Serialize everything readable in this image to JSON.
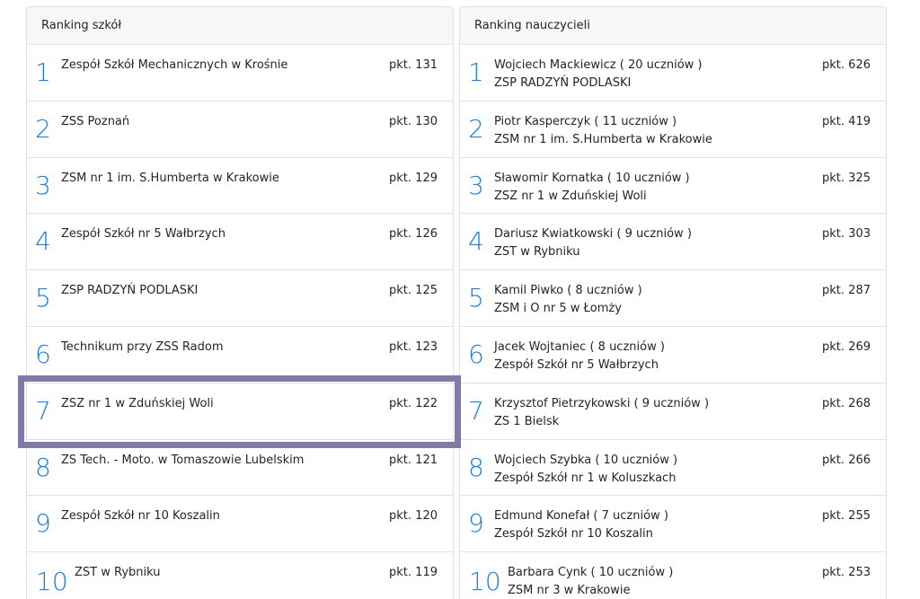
{
  "schools": {
    "title": "Ranking szkół",
    "rows": [
      {
        "rank": "1",
        "name": "Zespół Szkół Mechanicznych w Krośnie",
        "points": "pkt. 131"
      },
      {
        "rank": "2",
        "name": "ZSS Poznań",
        "points": "pkt. 130"
      },
      {
        "rank": "3",
        "name": "ZSM nr 1 im. S.Humberta w Krakowie",
        "points": "pkt. 129"
      },
      {
        "rank": "4",
        "name": "Zespół Szkół nr 5 Wałbrzych",
        "points": "pkt. 126"
      },
      {
        "rank": "5",
        "name": "ZSP RADZYŃ PODLASKI",
        "points": "pkt. 125"
      },
      {
        "rank": "6",
        "name": "Technikum przy ZSS Radom",
        "points": "pkt. 123"
      },
      {
        "rank": "7",
        "name": "ZSZ nr 1 w Zduńskiej Woli",
        "points": "pkt. 122"
      },
      {
        "rank": "8",
        "name": "ZS Tech. - Moto. w Tomaszowie Lubelskim",
        "points": "pkt. 121"
      },
      {
        "rank": "9",
        "name": "Zespół Szkół nr 10 Koszalin",
        "points": "pkt. 120"
      },
      {
        "rank": "10",
        "name": "ZST w Rybniku",
        "points": "pkt. 119"
      }
    ]
  },
  "teachers": {
    "title": "Ranking nauczycieli",
    "rows": [
      {
        "rank": "1",
        "name": "Wojciech Mackiewicz ( 20 uczniów )",
        "school": "ZSP RADZYŃ PODLASKI",
        "points": "pkt. 626"
      },
      {
        "rank": "2",
        "name": "Piotr Kasperczyk ( 11 uczniów )",
        "school": "ZSM nr 1 im. S.Humberta w Krakowie",
        "points": "pkt. 419"
      },
      {
        "rank": "3",
        "name": "Sławomir Kornatka ( 10 uczniów )",
        "school": "ZSZ nr 1 w Zduńskiej Woli",
        "points": "pkt. 325"
      },
      {
        "rank": "4",
        "name": "Dariusz Kwiatkowski ( 9 uczniów )",
        "school": "ZST w Rybniku",
        "points": "pkt. 303"
      },
      {
        "rank": "5",
        "name": "Kamil Piwko ( 8 uczniów )",
        "school": "ZSM i O nr 5 w Łomży",
        "points": "pkt. 287"
      },
      {
        "rank": "6",
        "name": "Jacek Wojtaniec ( 8 uczniów )",
        "school": "Zespół Szkół nr 5 Wałbrzych",
        "points": "pkt. 269"
      },
      {
        "rank": "7",
        "name": "Krzysztof Pietrzykowski ( 9 uczniów )",
        "school": "ZS 1 Bielsk",
        "points": "pkt. 268"
      },
      {
        "rank": "8",
        "name": "Wojciech Szybka ( 10 uczniów )",
        "school": "Zespół Szkół nr 1 w Koluszkach",
        "points": "pkt. 266"
      },
      {
        "rank": "9",
        "name": "Edmund Konefał ( 7 uczniów )",
        "school": "Zespół Szkół nr 10 Koszalin",
        "points": "pkt. 255"
      },
      {
        "rank": "10",
        "name": "Barbara Cynk ( 10 uczniów )",
        "school": "ZSM nr 3 w Krakowie",
        "points": "pkt. 253"
      }
    ]
  },
  "highlight_color": "#7f7ba6",
  "rank_color": "#1e7fe0"
}
